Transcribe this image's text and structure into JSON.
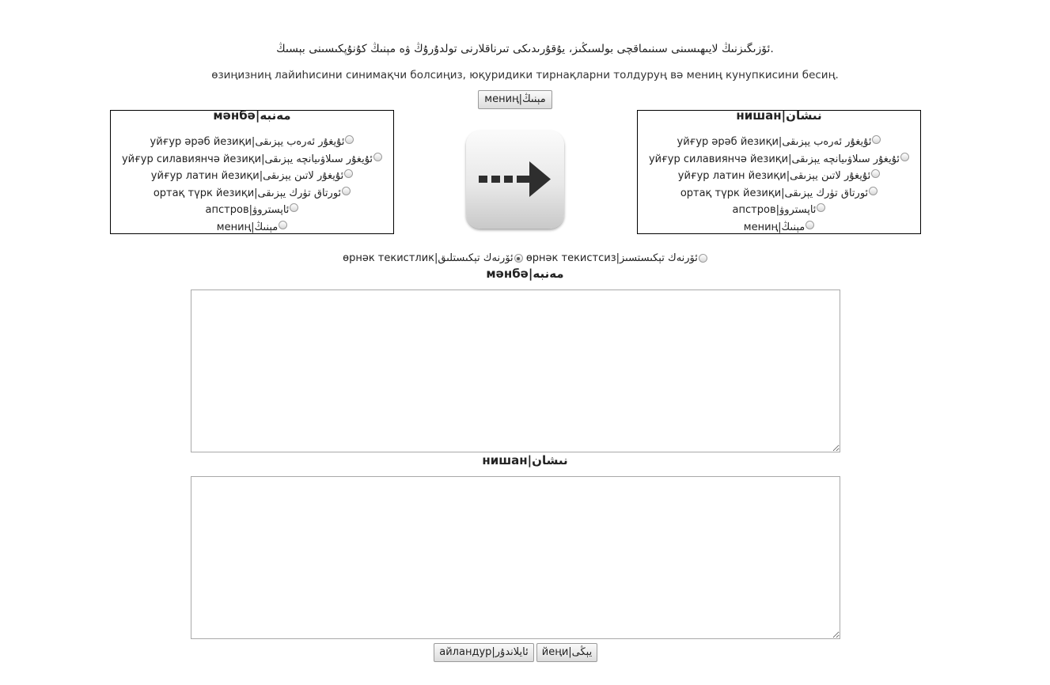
{
  "intro": {
    "uyghur": "ئۆزىگىزنىڭ لايىھىسىنى سىنىماقچى بولسىڭىز، يۇقۇرىدىكى تىرناقلارنى تولدۇرۇڭ ۋە مېنىڭ كۇنۇپكىسىنى بېسىڭ.",
    "cyrillic": "өзиңизниң лайиһисини синимақчи болсиңиз, юқуридики тирнақларни толдуруң вә мениң кунупкисини бесиң."
  },
  "my_button": "мениң|مېنىڭ",
  "source_panel": {
    "title": "мәнбә|مەنبە",
    "options": [
      {
        "label": "уйғур әрәб йезиқи|ئۇيغۇر ئەرەب يېزىقى",
        "checked": false
      },
      {
        "label": "уйғур силавиянчә йезиқи|ئۇيغۇر سىلاۋىيانچە يېزىقى",
        "checked": false
      },
      {
        "label": "уйғур латин йезиқи|ئۇيغۇر لاتىن يېزىقى",
        "checked": false
      },
      {
        "label": "ортақ түрк йезиқи|ئورتاق تۈرك يېزىقى",
        "checked": false
      },
      {
        "label": "апстров|ئاپستروۋ",
        "checked": false
      },
      {
        "label": "мениң|مېنىڭ",
        "checked": false
      }
    ]
  },
  "target_panel": {
    "title": "нишан|نىشان",
    "options": [
      {
        "label": "уйғур әрәб йезиқи|ئۇيغۇر ئەرەب يېزىقى",
        "checked": false
      },
      {
        "label": "уйғур силавиянчә йезиқи|ئۇيغۇر سىلاۋىيانچە يېزىقى",
        "checked": false
      },
      {
        "label": "уйғур латин йезиқи|ئۇيغۇر لاتىن يېزىقى",
        "checked": false
      },
      {
        "label": "ортақ түрк йезиқи|ئورتاق تۈرك يېزىقى",
        "checked": false
      },
      {
        "label": "апстров|ئاپستروۋ",
        "checked": false
      },
      {
        "label": "мениң|مېنىڭ",
        "checked": false
      }
    ]
  },
  "sample_options": [
    {
      "label": "өрнәк текистлик|ئۆرنەك تېكىستلىق",
      "checked": true
    },
    {
      "label": "өрнәк текистсиз|ئۆرنەك تېكىستسىز",
      "checked": false
    }
  ],
  "source_label": "мәнбә|مەنبە",
  "target_label": "нишан|نىشان",
  "source_text": "",
  "target_text": "",
  "convert_button": "айландур|ئايلاندۇر",
  "new_button": "йеңи|يېڭى",
  "icons": {
    "arrow": "right-arrow-icon"
  }
}
